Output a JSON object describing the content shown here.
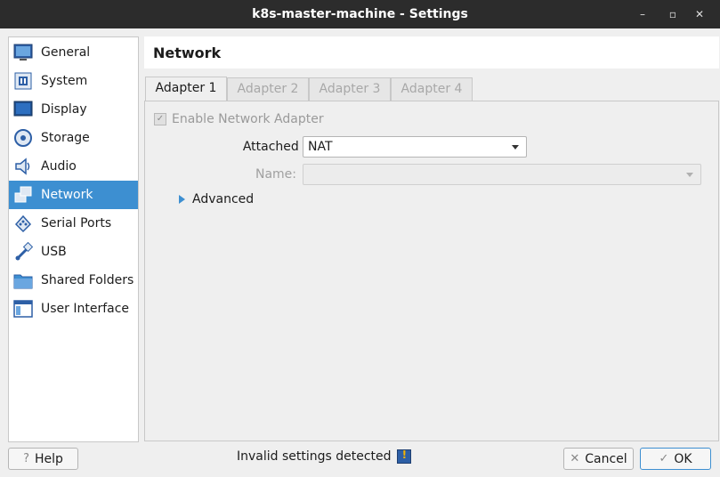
{
  "window": {
    "title": "k8s-master-machine - Settings",
    "minimize_glyph": "–",
    "maximize_glyph": "▫",
    "close_glyph": "✕"
  },
  "sidebar": {
    "items": [
      {
        "label": "General",
        "icon": "general-icon"
      },
      {
        "label": "System",
        "icon": "system-icon"
      },
      {
        "label": "Display",
        "icon": "display-icon"
      },
      {
        "label": "Storage",
        "icon": "storage-icon"
      },
      {
        "label": "Audio",
        "icon": "audio-icon"
      },
      {
        "label": "Network",
        "icon": "network-icon",
        "selected": true
      },
      {
        "label": "Serial Ports",
        "icon": "serial-ports-icon"
      },
      {
        "label": "USB",
        "icon": "usb-icon"
      },
      {
        "label": "Shared Folders",
        "icon": "shared-folders-icon"
      },
      {
        "label": "User Interface",
        "icon": "user-interface-icon"
      }
    ]
  },
  "page": {
    "title": "Network",
    "tabs": [
      {
        "label": "Adapter 1",
        "active": true
      },
      {
        "label": "Adapter 2",
        "active": false
      },
      {
        "label": "Adapter 3",
        "active": false
      },
      {
        "label": "Adapter 4",
        "active": false
      }
    ],
    "enable_adapter": {
      "label": "Enable Network Adapter",
      "checked": true,
      "disabled": true
    },
    "attached_to": {
      "label": "Attached to:",
      "value": "NAT"
    },
    "name": {
      "label": "Name:",
      "value": "",
      "disabled": true
    },
    "advanced": {
      "label": "Advanced",
      "expanded": false
    }
  },
  "footer": {
    "help_label": "Help",
    "status_text": "Invalid settings detected",
    "cancel_label": "Cancel",
    "ok_label": "OK"
  },
  "colors": {
    "accent": "#3d8fd1",
    "titlebar": "#2c2c2c",
    "background": "#efefef"
  }
}
